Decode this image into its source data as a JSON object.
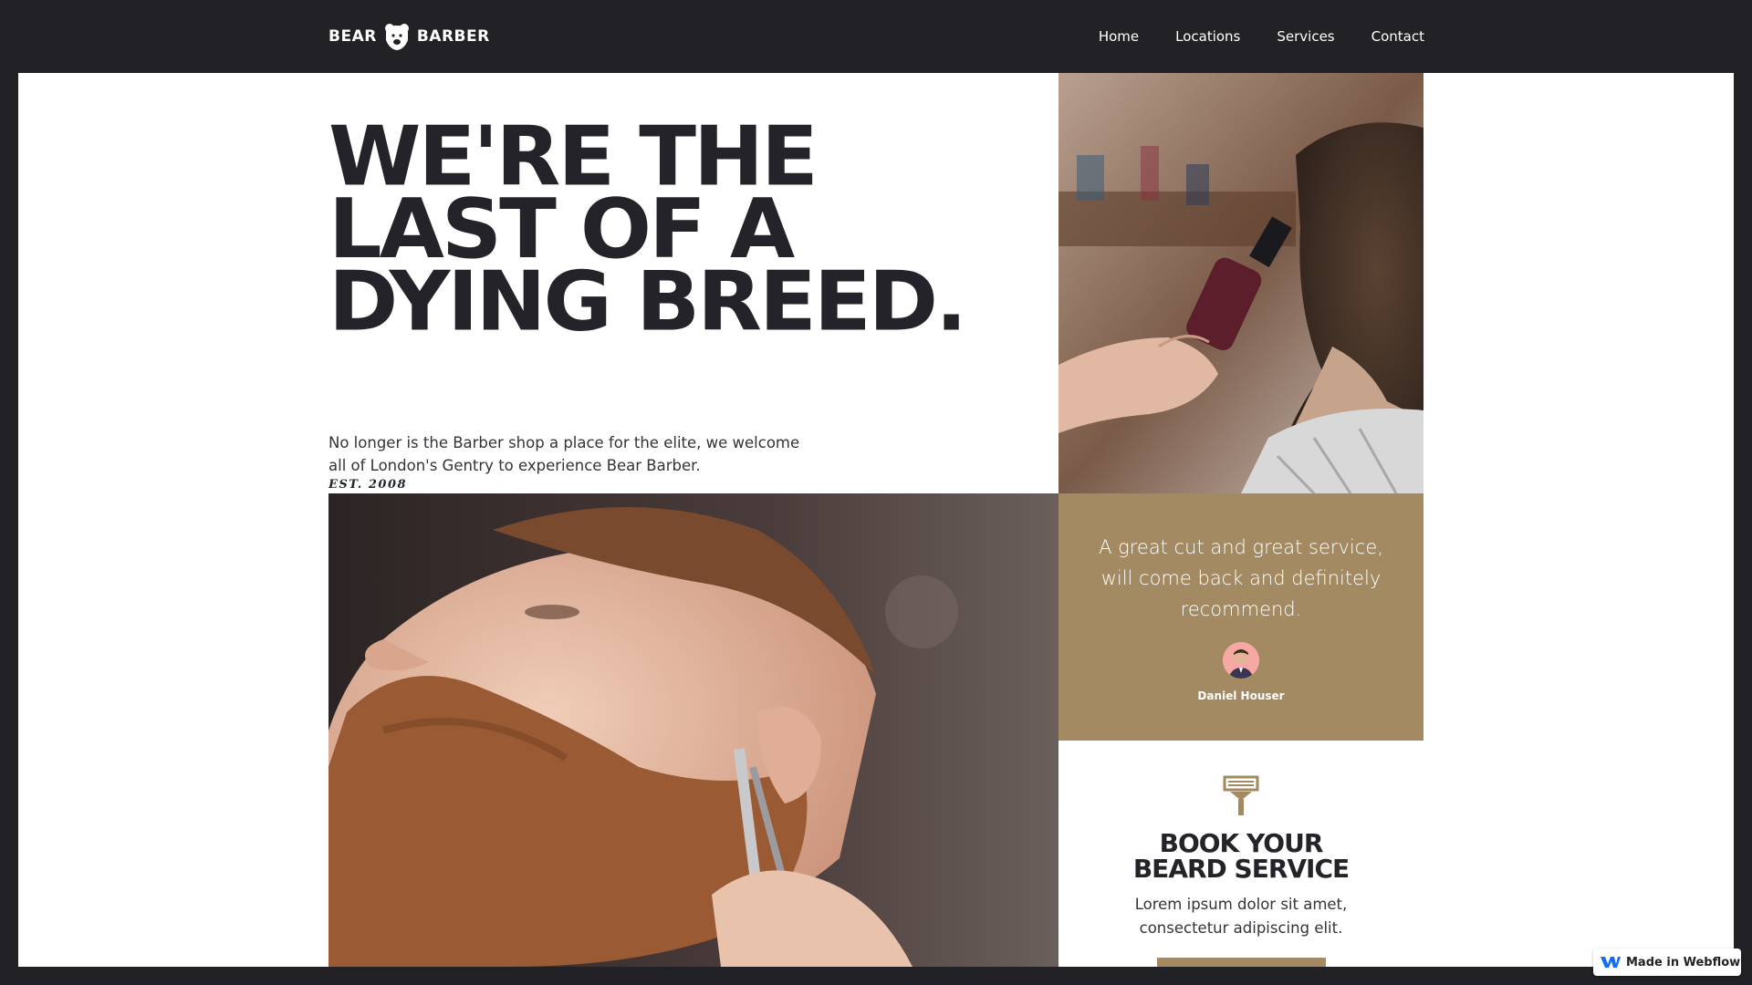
{
  "nav": {
    "logo_left": "BEAR",
    "logo_right": "BARBER",
    "links": [
      "Home",
      "Locations",
      "Services",
      "Contact"
    ]
  },
  "hero": {
    "title_lines": [
      "WE'RE THE",
      "LAST OF A",
      "DYING BREED."
    ],
    "subtitle": "No longer is the Barber shop a place for the elite, we welcome all of London's Gentry to experience Bear Barber.",
    "established": "EST. 2008"
  },
  "testimonial": {
    "quote": "A great cut and great service, will come back and definitely recommend.",
    "author": "Daniel Houser"
  },
  "book": {
    "icon": "razor-icon",
    "title_lines": [
      "BOOK YOUR",
      "BEARD SERVICE"
    ],
    "description": "Lorem ipsum dolor sit amet, consectetur adipiscing elit."
  },
  "badge": {
    "text": "Made in Webflow"
  },
  "colors": {
    "dark": "#222226",
    "accent": "#a38a62",
    "text": "#232329"
  }
}
